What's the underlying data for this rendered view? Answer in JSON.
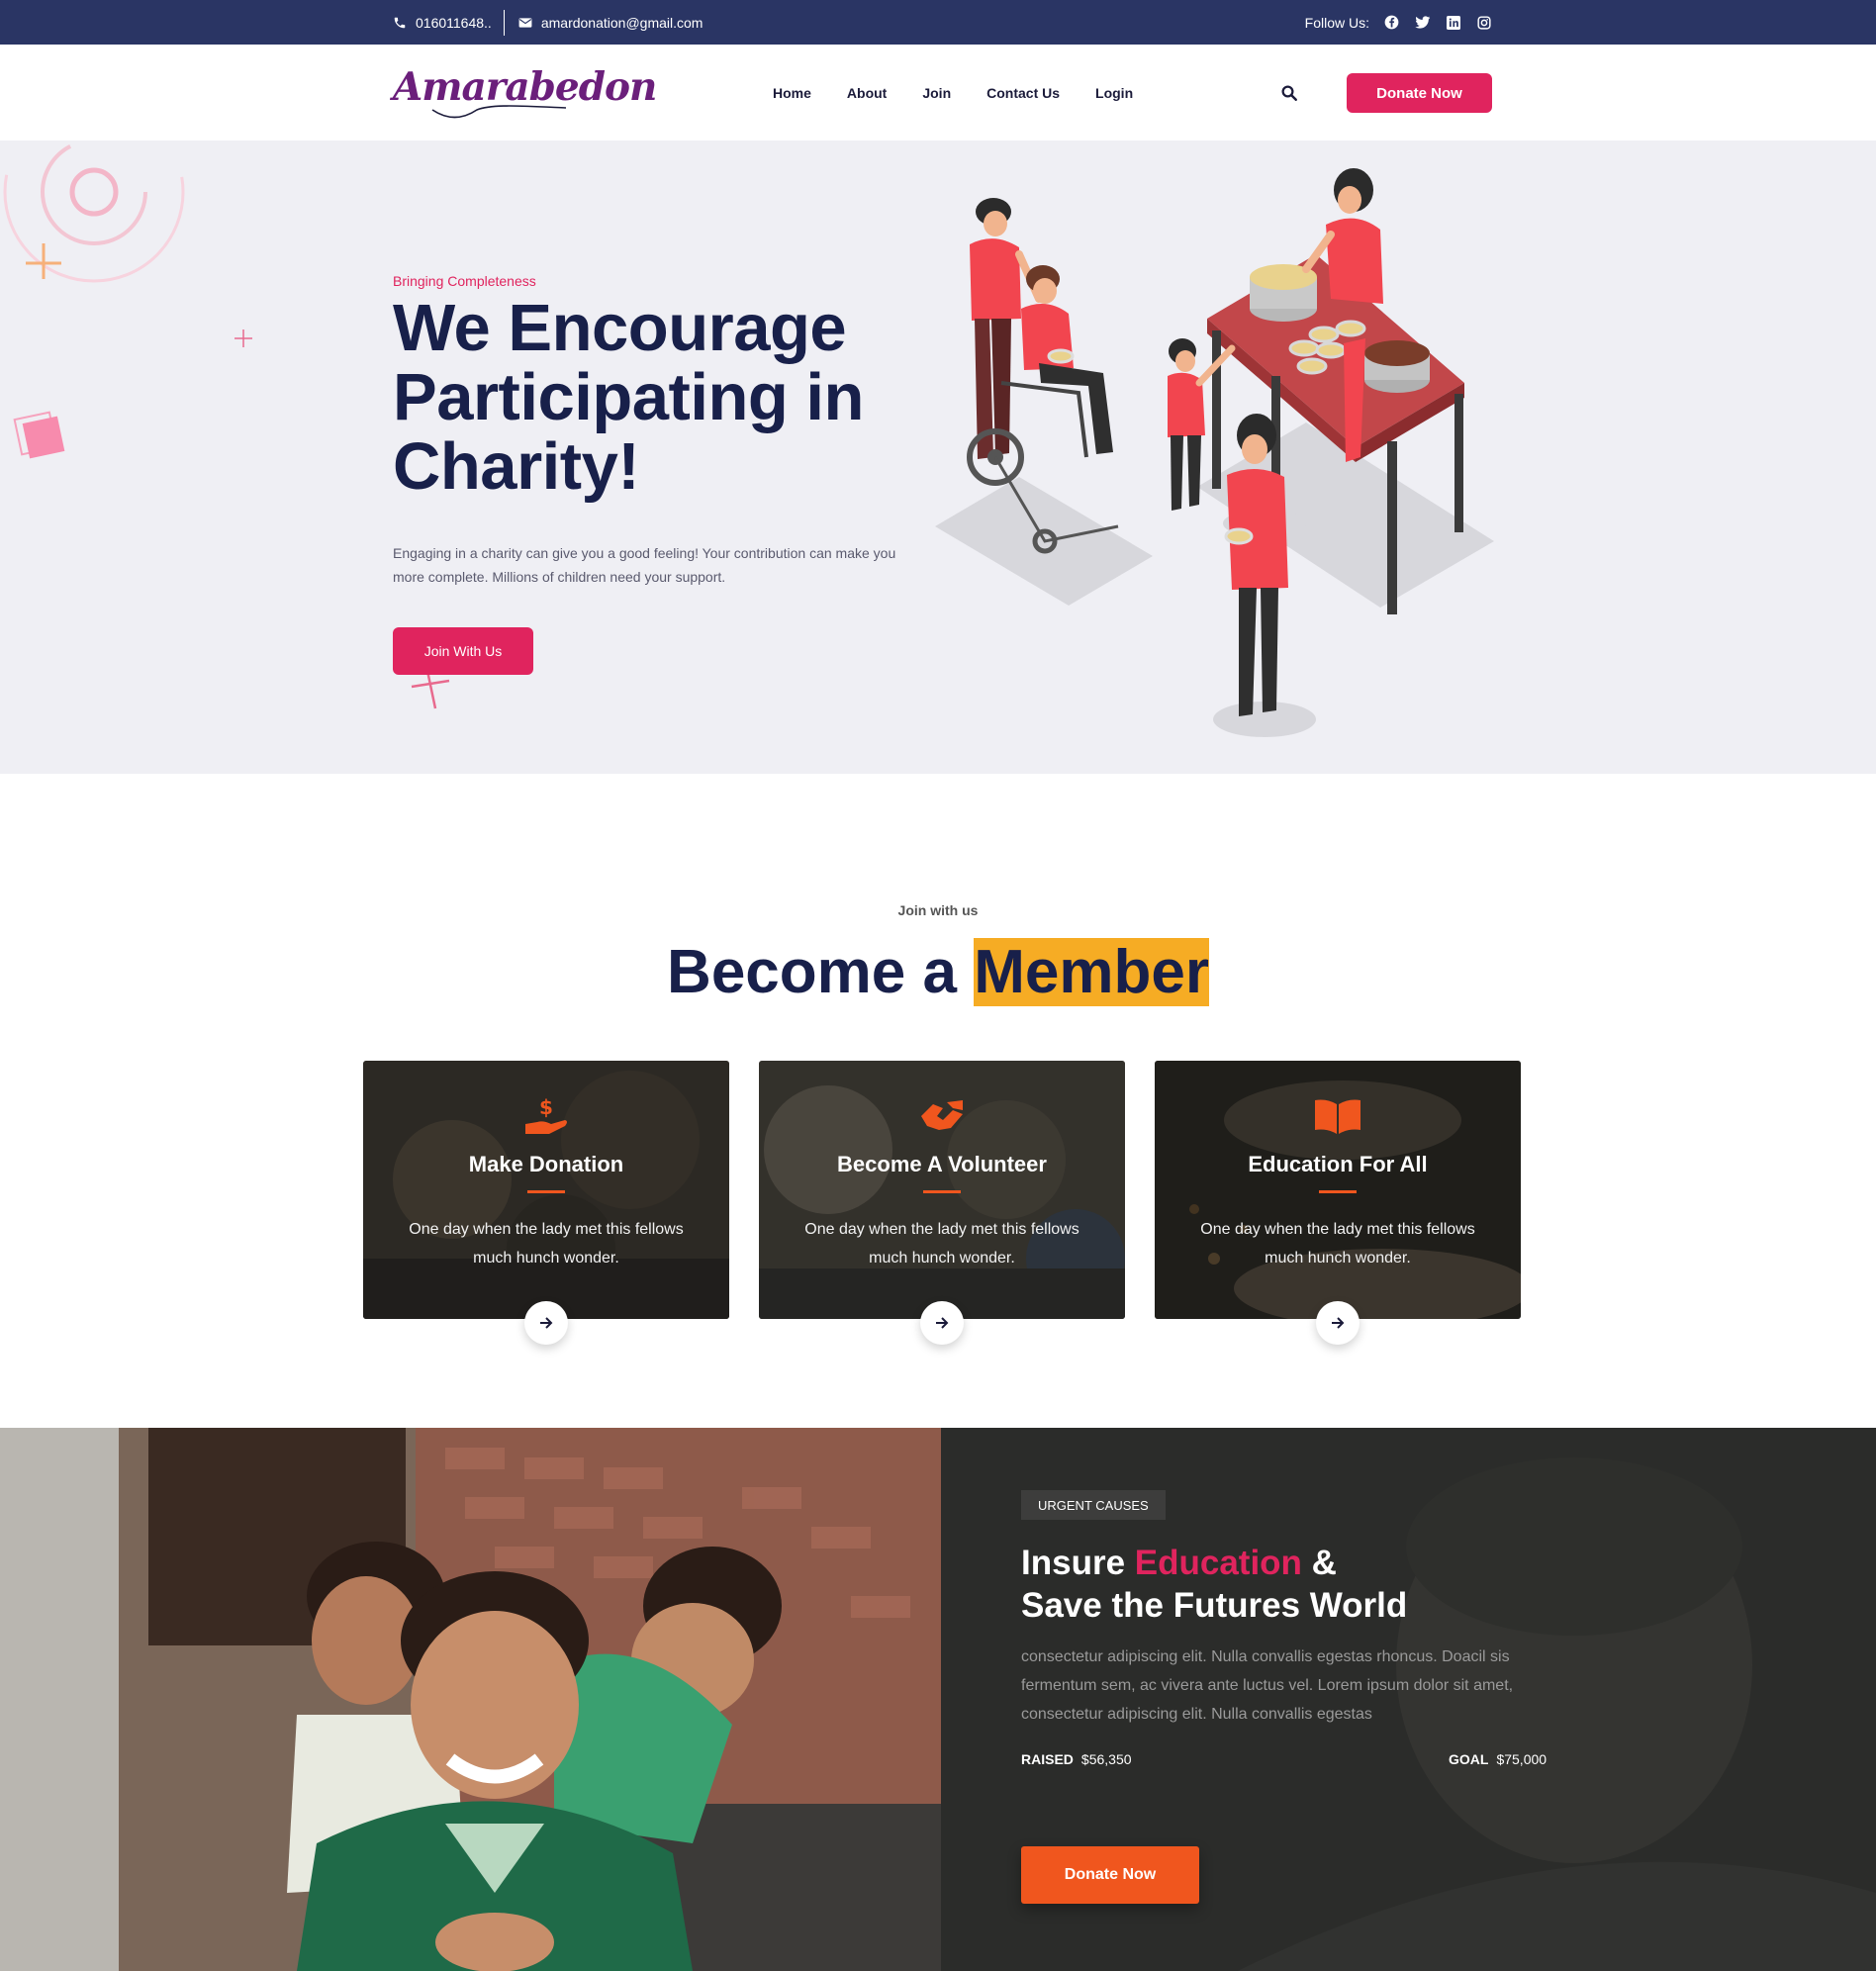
{
  "topbar": {
    "phone": "016011648..",
    "email": "amardonation@gmail.com",
    "follow_label": "Follow Us:",
    "social": [
      "facebook-icon",
      "twitter-icon",
      "linkedin-icon",
      "instagram-icon"
    ]
  },
  "header": {
    "logo": "Amarabedon",
    "nav": [
      "Home",
      "About",
      "Join",
      "Contact Us",
      "Login"
    ],
    "donate_label": "Donate Now"
  },
  "hero": {
    "eyebrow": "Bringing Completeness",
    "title": "We Encourage Participating in Charity!",
    "text": "Engaging in a charity can give you a good feeling! Your contribution can make you more complete. Millions of children need your support.",
    "button": "Join With Us"
  },
  "member": {
    "eyebrow": "Join with us",
    "title_plain": "Become a ",
    "title_highlight": "Member",
    "cards": [
      {
        "title": "Make Donation",
        "text": "One day when the lady met this fellows much hunch wonder.",
        "icon": "donation-hand-icon"
      },
      {
        "title": "Become A Volunteer",
        "text": "One day when the lady met this fellows much hunch wonder.",
        "icon": "handshake-icon"
      },
      {
        "title": "Education For All",
        "text": "One day when the lady met this fellows much hunch wonder.",
        "icon": "book-icon"
      }
    ]
  },
  "urgent": {
    "badge": "URGENT CAUSES",
    "title_1": "Insure ",
    "title_highlight": "Education",
    "title_2": " &",
    "title_3": "Save the Futures World",
    "text": "consectetur adipiscing elit. Nulla convallis egestas rhoncus. Doacil sis fermentum sem, ac vivera ante luctus vel. Lorem ipsum dolor sit amet, consectetur adipiscing elit. Nulla convallis egestas",
    "raised_label": "RAISED",
    "raised_value": "$56,350",
    "goal_label": "GOAL",
    "goal_value": "$75,000",
    "button": "Donate Now"
  },
  "colors": {
    "topbar": "#2a3564",
    "accent_pink": "#e0245e",
    "accent_orange": "#f0561e",
    "highlight_yellow": "#f6ac24",
    "heading_navy": "#18204a"
  }
}
